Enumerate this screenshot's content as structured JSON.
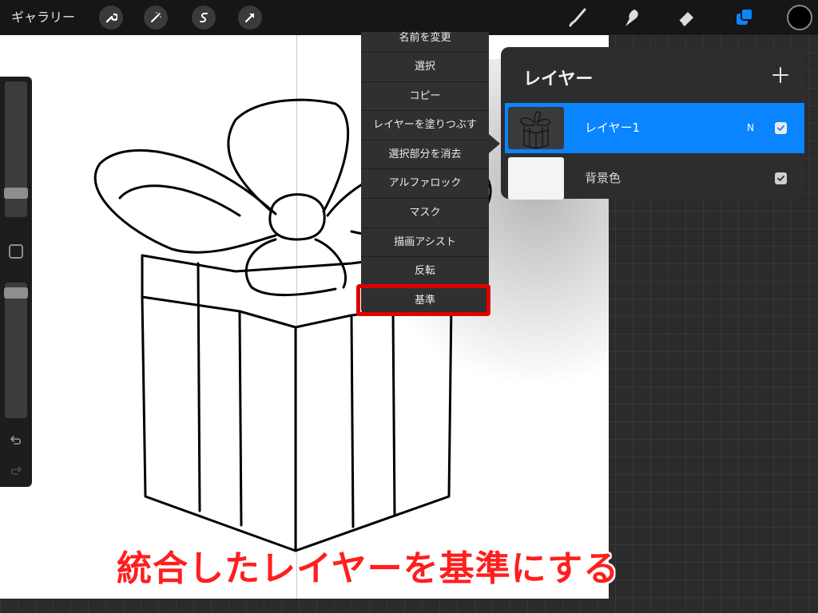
{
  "topbar": {
    "gallery_label": "ギャラリー",
    "tools_left": [
      "wrench-icon",
      "magic-wand-icon",
      "selection-s-icon",
      "transform-arrow-icon"
    ],
    "tools_right": [
      "brush-icon",
      "smudge-icon",
      "eraser-icon",
      "layers-icon"
    ],
    "active_tool": "layers-icon",
    "accent_color": "#0a84ff",
    "current_color": "#000000"
  },
  "sidebar": {
    "brush_size_level": 0.78,
    "opacity_level": 0.04
  },
  "context_menu": {
    "items": [
      "名前を変更",
      "選択",
      "コピー",
      "レイヤーを塗りつぶす",
      "選択部分を消去",
      "アルファロック",
      "マスク",
      "描画アシスト",
      "反転",
      "基準"
    ],
    "highlighted_item": "基準",
    "highlight_color": "#e00000"
  },
  "layers_panel": {
    "title": "レイヤー",
    "layers": [
      {
        "name": "レイヤー1",
        "mode": "N",
        "visible": true,
        "selected": true
      },
      {
        "name": "背景色",
        "mode": "",
        "visible": true,
        "selected": false
      }
    ]
  },
  "caption": {
    "text": "統合したレイヤーを基準にする",
    "color": "#ff1e1e"
  }
}
